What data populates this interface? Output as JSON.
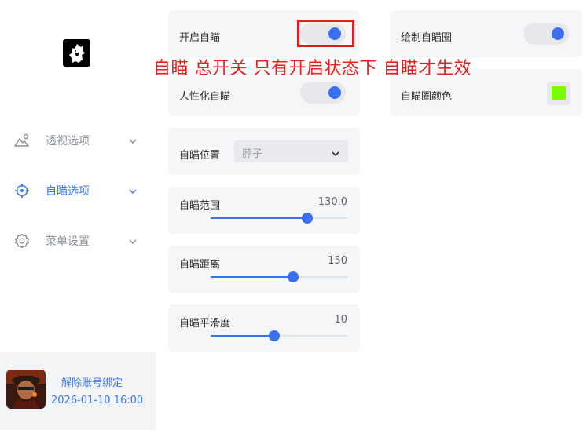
{
  "sidebar": {
    "logo_icon": "wolf-logo-icon",
    "items": [
      {
        "label": "透视选项",
        "icon": "mountain-person-icon",
        "active": false
      },
      {
        "label": "自瞄选项",
        "icon": "crosshair-icon",
        "active": true
      },
      {
        "label": "菜单设置",
        "icon": "gear-icon",
        "active": false
      }
    ],
    "account": {
      "unbind_label": "解除账号绑定",
      "expire_time": "2026-01-10 16:00"
    }
  },
  "settings": {
    "aimbot_enable": {
      "label": "开启自瞄",
      "on": true
    },
    "humanize": {
      "label": "人性化自瞄",
      "on": true
    },
    "aim_position": {
      "label": "自瞄位置",
      "value": "脖子"
    },
    "aim_range": {
      "label": "自瞄范围",
      "value": "130.0",
      "fraction": 0.7
    },
    "aim_distance": {
      "label": "自瞄距离",
      "value": "150",
      "fraction": 0.6
    },
    "aim_smooth": {
      "label": "自瞄平滑度",
      "value": "10",
      "fraction": 0.46
    },
    "draw_circle": {
      "label": "绘制自瞄圈",
      "on": true
    },
    "circle_color": {
      "label": "自瞄圈颜色",
      "color": "#7cfc00"
    }
  },
  "annotation": {
    "text": "自瞄 总开关 只有开启状态下 自瞄才生效",
    "color": "#e82020"
  },
  "colors": {
    "accent": "#3a7bf0",
    "toggle_knob": "#3a6ff0"
  }
}
